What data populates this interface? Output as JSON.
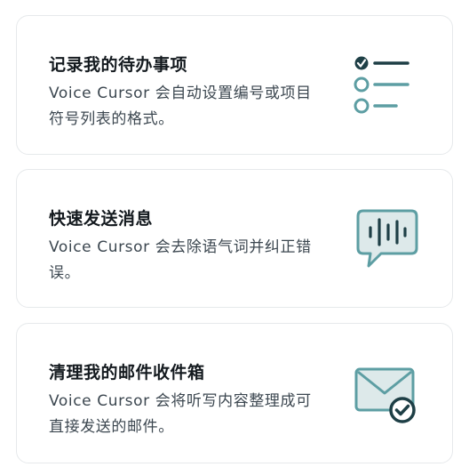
{
  "cards": [
    {
      "title": "记录我的待办事项",
      "description": "Voice Cursor 会自动设置编号或项目符号列表的格式。",
      "icon": "checklist-icon"
    },
    {
      "title": "快速发送消息",
      "description": "Voice Cursor 会去除语气词并纠正错误。",
      "icon": "voice-message-icon"
    },
    {
      "title": "清理我的邮件收件箱",
      "description": "Voice Cursor 会将听写内容整理成可直接发送的邮件。",
      "icon": "email-check-icon"
    }
  ],
  "colors": {
    "icon_dark": "#1e3f46",
    "icon_teal": "#5d9ea3",
    "icon_fill": "#dde9ea",
    "border": "#e6e9eb",
    "title": "#141a1f",
    "description": "#3c4750"
  }
}
